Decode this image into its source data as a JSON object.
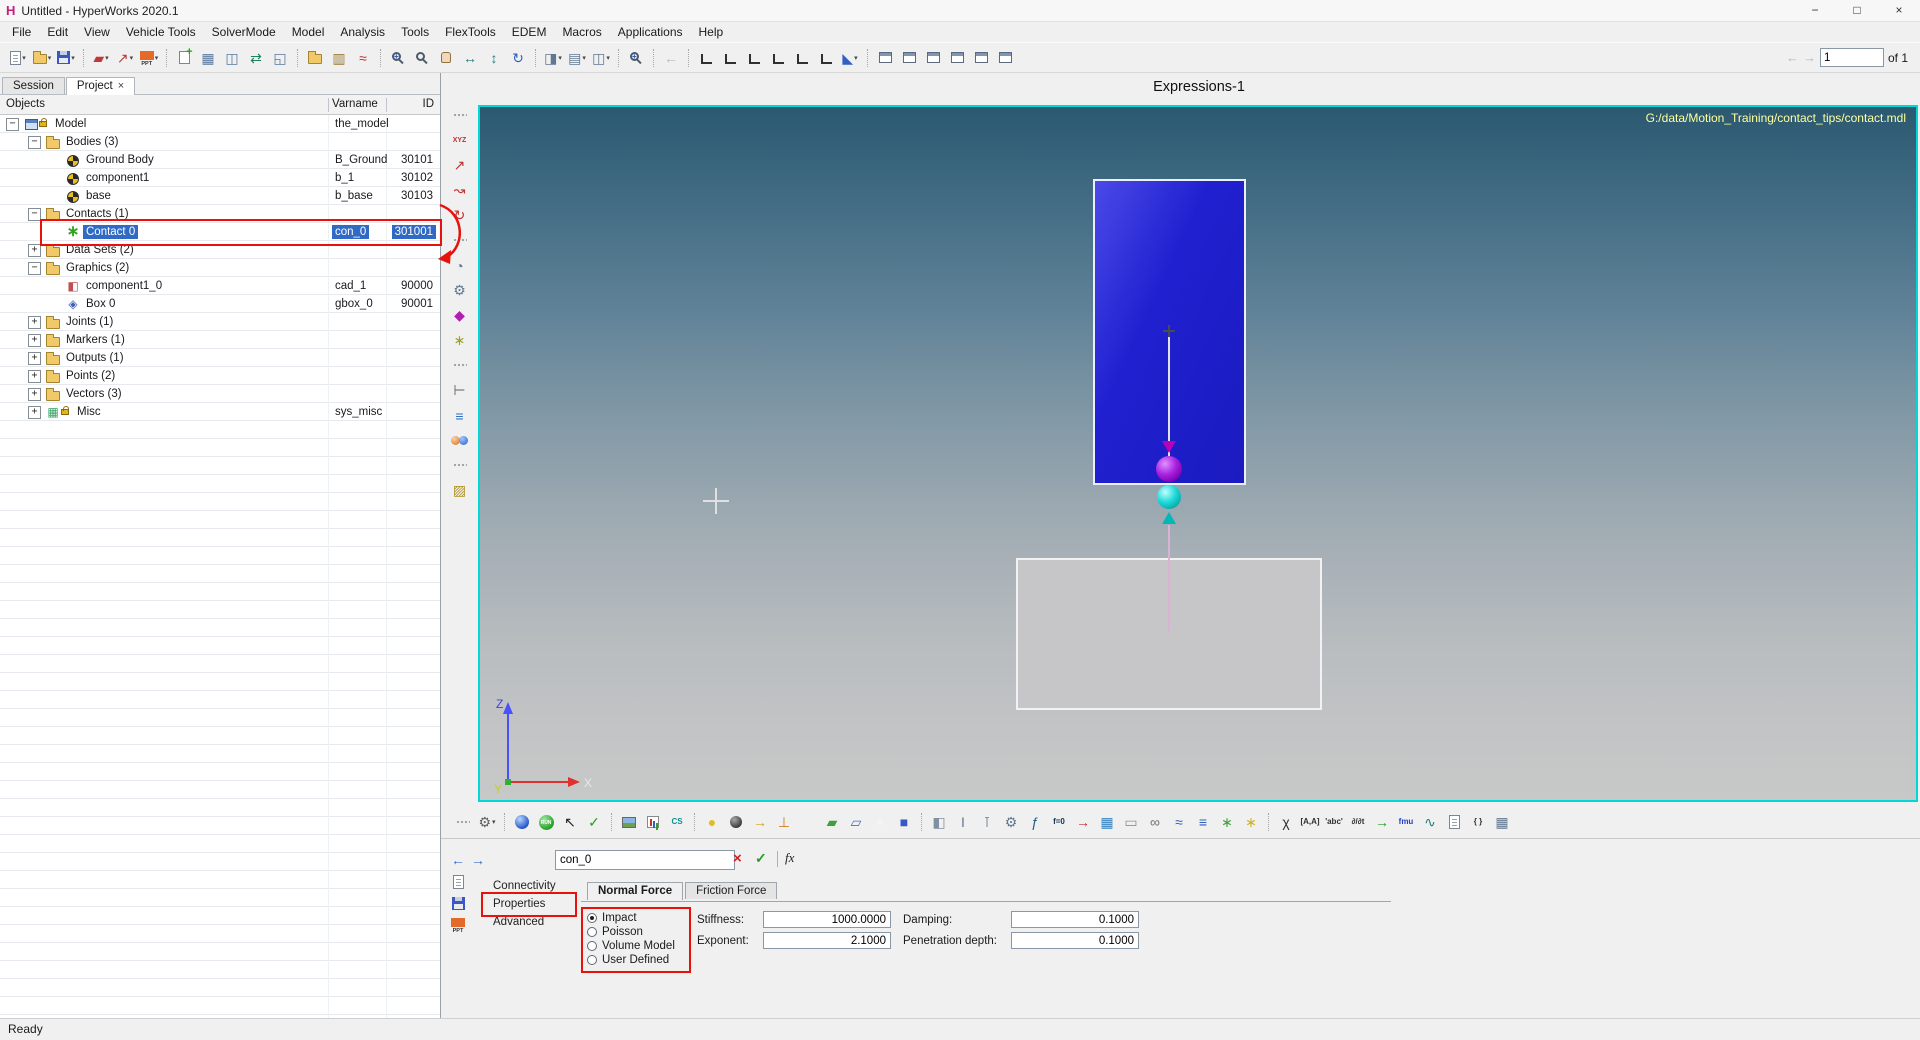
{
  "window": {
    "logo": "H",
    "title": "Untitled - HyperWorks 2020.1",
    "status": "Ready",
    "controls": {
      "minimize": "−",
      "maximize": "□",
      "close": "×"
    }
  },
  "menu": {
    "items": [
      "File",
      "Edit",
      "View",
      "Vehicle Tools",
      "SolverMode",
      "Model",
      "Analysis",
      "Tools",
      "FlexTools",
      "EDEM",
      "Macros",
      "Applications",
      "Help"
    ]
  },
  "toolbar": {
    "right": {
      "back": "←",
      "forward": "→",
      "page_value": "1",
      "page_of": "of 1"
    },
    "groups": [
      [
        {
          "n": "new-session-icon",
          "k": "page",
          "dd": true
        },
        {
          "n": "open-file-icon",
          "k": "folder",
          "dd": true
        },
        {
          "n": "save-file-icon",
          "k": "floppy",
          "dd": true
        }
      ],
      [
        {
          "n": "annotation-tool-icon",
          "g": "▰",
          "c": "#c03838",
          "dd": true
        },
        {
          "n": "measure-tool-icon",
          "g": "↗",
          "c": "#c03838",
          "dd": true
        },
        {
          "n": "ppt-export-icon",
          "g": "PPT",
          "k": "ppt",
          "dd": true
        }
      ],
      [
        {
          "n": "add-page-icon",
          "k": "addpage"
        },
        {
          "n": "page-layout-icon",
          "g": "▦",
          "c": "#5878a0"
        },
        {
          "n": "split-window-icon",
          "g": "◫",
          "c": "#5878a0"
        },
        {
          "n": "swap-windows-icon",
          "g": "⇄",
          "c": "#208060"
        },
        {
          "n": "expand-window-icon",
          "g": "◱",
          "c": "#5878a0"
        }
      ],
      [
        {
          "n": "organize-sessions-icon",
          "k": "folder"
        },
        {
          "n": "session-report-icon",
          "g": "▥",
          "c": "#9a7830"
        },
        {
          "n": "plot-curve-icon",
          "g": "≈",
          "c": "#c03030"
        }
      ],
      [
        {
          "n": "zoom-in-icon",
          "k": "magplus"
        },
        {
          "n": "zoom-window-icon",
          "k": "mag"
        },
        {
          "n": "pan-icon",
          "k": "hand"
        },
        {
          "n": "fit-horizontal-icon",
          "g": "↔",
          "c": "#208080"
        },
        {
          "n": "fit-vertical-icon",
          "g": "↕",
          "c": "#208080"
        },
        {
          "n": "free-rotate-icon",
          "g": "↻",
          "c": "#3060c0"
        }
      ],
      [
        {
          "n": "copy-icon",
          "g": "◨",
          "c": "#607890",
          "dd": true
        },
        {
          "n": "paste-icon",
          "g": "▤",
          "c": "#607890",
          "dd": true
        },
        {
          "n": "capture-image-icon",
          "g": "◫",
          "c": "#607890",
          "dd": true
        }
      ],
      [
        {
          "n": "screen-zoom-icon",
          "k": "magplus"
        }
      ],
      [
        {
          "n": "view-back-arrow-icon",
          "g": "←",
          "c": "#b8b8b8"
        }
      ],
      [
        {
          "n": "view-top-icon",
          "k": "view"
        },
        {
          "n": "view-bottom-icon",
          "k": "view"
        },
        {
          "n": "view-left-icon",
          "k": "view"
        },
        {
          "n": "view-right-icon",
          "k": "view"
        },
        {
          "n": "view-front-icon",
          "k": "view"
        },
        {
          "n": "view-rear-icon",
          "k": "view"
        },
        {
          "n": "iso-view-icon",
          "g": "◣",
          "c": "#3060c0",
          "dd": true
        }
      ],
      [
        {
          "n": "new-window-icon",
          "k": "win"
        },
        {
          "n": "cascade-windows-icon",
          "k": "win"
        },
        {
          "n": "tile-horizontal-icon",
          "k": "win"
        },
        {
          "n": "tile-vertical-icon",
          "k": "win"
        },
        {
          "n": "restore-windows-icon",
          "k": "win"
        },
        {
          "n": "close-window-icon",
          "k": "win"
        }
      ]
    ]
  },
  "browser": {
    "tabs": [
      {
        "label": "Session"
      },
      {
        "label": "Project",
        "close": "×"
      }
    ],
    "columns": {
      "objects": "Objects",
      "varname": "Varname",
      "id": "ID"
    },
    "rows": [
      {
        "label": "Model",
        "var": "the_model",
        "id": "",
        "lvl": 0,
        "exp": "minus",
        "icon": "model",
        "lock": true
      },
      {
        "label": "Bodies (3)",
        "var": "",
        "id": "",
        "lvl": 1,
        "exp": "minus",
        "icon": "folder"
      },
      {
        "label": "Ground Body",
        "var": "B_Ground",
        "id": "30101",
        "lvl": 2,
        "icon": "body"
      },
      {
        "label": "component1",
        "var": "b_1",
        "id": "30102",
        "lvl": 2,
        "icon": "body"
      },
      {
        "label": "base",
        "var": "b_base",
        "id": "30103",
        "lvl": 2,
        "icon": "body"
      },
      {
        "label": "Contacts (1)",
        "var": "",
        "id": "",
        "lvl": 1,
        "exp": "minus",
        "icon": "folder"
      },
      {
        "label": "Contact 0",
        "var": "con_0",
        "id": "301001",
        "lvl": 2,
        "icon": "contact",
        "selected": true
      },
      {
        "label": "Data Sets (2)",
        "var": "",
        "id": "",
        "lvl": 1,
        "exp": "plus",
        "icon": "folder"
      },
      {
        "label": "Graphics (2)",
        "var": "",
        "id": "",
        "lvl": 1,
        "exp": "minus",
        "icon": "folder"
      },
      {
        "label": "component1_0",
        "var": "cad_1",
        "id": "90000",
        "lvl": 2,
        "icon": "cad"
      },
      {
        "label": "Box 0",
        "var": "gbox_0",
        "id": "90001",
        "lvl": 2,
        "icon": "gbox"
      },
      {
        "label": "Joints (1)",
        "var": "",
        "id": "",
        "lvl": 1,
        "exp": "plus",
        "icon": "folder"
      },
      {
        "label": "Markers (1)",
        "var": "",
        "id": "",
        "lvl": 1,
        "exp": "plus",
        "icon": "folder"
      },
      {
        "label": "Outputs (1)",
        "var": "",
        "id": "",
        "lvl": 1,
        "exp": "plus",
        "icon": "folder"
      },
      {
        "label": "Points (2)",
        "var": "",
        "id": "",
        "lvl": 1,
        "exp": "plus",
        "icon": "folder"
      },
      {
        "label": "Vectors (3)",
        "var": "",
        "id": "",
        "lvl": 1,
        "exp": "plus",
        "icon": "folder"
      },
      {
        "label": "Misc",
        "var": "sys_misc",
        "id": "",
        "lvl": 1,
        "exp": "plus",
        "icon": "misc",
        "lock": true
      }
    ]
  },
  "side_toolbar": {
    "icons": [
      {
        "n": "grip",
        "k": "grip"
      },
      {
        "n": "xyz-triad-icon",
        "g": "XYZ",
        "c": "#c03030",
        "sm": true
      },
      {
        "n": "translate-tool-icon",
        "g": "↗",
        "c": "#c03030"
      },
      {
        "n": "trace-tool-icon",
        "g": "↝",
        "c": "#c03030"
      },
      {
        "n": "rotate-tool-icon",
        "g": "↻",
        "c": "#c03030"
      },
      {
        "n": "grip",
        "k": "grip"
      },
      {
        "n": "protractor-icon",
        "g": "◔",
        "c": "#607890"
      },
      {
        "n": "mechanism-icon",
        "g": "⚙",
        "c": "#607890"
      },
      {
        "n": "marker-tool-icon",
        "g": "◆",
        "c": "#b020b0"
      },
      {
        "n": "snap-tool-icon",
        "g": "∗",
        "c": "#a0a020"
      },
      {
        "n": "grip",
        "k": "grip"
      },
      {
        "n": "ruler-icon",
        "g": "⊢",
        "c": "#606060"
      },
      {
        "n": "legend-bars-icon",
        "g": "≡",
        "c": "#3070c0"
      },
      {
        "n": "contact-spheres-icon",
        "k": "balls"
      },
      {
        "n": "grip",
        "k": "grip"
      },
      {
        "n": "paint-tool-icon",
        "g": "▨",
        "c": "#b09020"
      }
    ]
  },
  "viewport": {
    "title": "Expressions-1",
    "file_path": "G:/data/Motion_Training/contact_tips/contact.mdl",
    "axis": {
      "x": "X",
      "y": "Y",
      "z": "Z"
    }
  },
  "bottom_toolbar": {
    "groups": [
      [
        {
          "n": "grip",
          "k": "grip"
        },
        {
          "n": "model-tools-icon",
          "g": "⚙",
          "c": "#606060",
          "dd": true
        }
      ],
      [
        {
          "n": "sphere-display-icon",
          "k": "sphereblue"
        },
        {
          "n": "run-solver-icon",
          "g": "RUN",
          "k": "run"
        },
        {
          "n": "select-cursor-icon",
          "g": "↖",
          "c": "#202020"
        },
        {
          "n": "verify-model-icon",
          "g": "✓",
          "c": "#20a020"
        }
      ],
      [
        {
          "n": "snapshot-icon",
          "k": "photo"
        },
        {
          "n": "plot-window-icon",
          "k": "chart"
        },
        {
          "n": "cs-marker-icon",
          "g": "CS",
          "c": "#109090",
          "sm": true
        }
      ],
      [
        {
          "n": "point-entity-icon",
          "g": "●",
          "c": "#e0c020"
        },
        {
          "n": "body-entity-icon",
          "k": "balldark"
        },
        {
          "n": "vector-entity-icon",
          "g": "→",
          "c": "#d0a020"
        },
        {
          "n": "marker-entity-icon",
          "g": "⊥",
          "c": "#d08020"
        },
        {
          "n": "asterisk-entity-icon",
          "g": "∗",
          "c": "#f0f0f0"
        },
        {
          "n": "surface-entity-icon",
          "g": "▰",
          "c": "#40a040"
        },
        {
          "n": "plane-entity-icon",
          "g": "▱",
          "c": "#4070d0"
        },
        {
          "n": "cross-entity-icon",
          "g": "+",
          "c": "#f8f8f8"
        },
        {
          "n": "solid-entity-icon",
          "g": "■",
          "c": "#3858c8"
        }
      ],
      [
        {
          "n": "rigid-group-icon",
          "g": "◧",
          "c": "#8090a0"
        },
        {
          "n": "beam-icon",
          "g": "I",
          "c": "#607890"
        },
        {
          "n": "pin-joint-icon",
          "g": "⊺",
          "c": "#607890"
        },
        {
          "n": "gear-joint-icon",
          "g": "⚙",
          "c": "#607890"
        },
        {
          "n": "force-icon",
          "g": "ƒ",
          "c": "#206080"
        },
        {
          "n": "equation-icon",
          "g": "f=0",
          "c": "#103050",
          "sm": true
        },
        {
          "n": "output-request-icon",
          "g": "→",
          "c": "#c03030"
        },
        {
          "n": "table-icon",
          "g": "▦",
          "c": "#3080c0"
        },
        {
          "n": "capsule-icon",
          "g": "▭",
          "c": "#909090"
        },
        {
          "n": "contact-pair-icon",
          "g": "∞",
          "c": "#707070"
        },
        {
          "n": "bushing-icon",
          "g": "≈",
          "c": "#3060c0"
        },
        {
          "n": "layers-icon",
          "g": "≡",
          "c": "#3060c0"
        },
        {
          "n": "coupler-icon",
          "g": "∗",
          "c": "#40a040"
        },
        {
          "n": "flexbody-icon",
          "g": "∗",
          "c": "#d0b020"
        }
      ],
      [
        {
          "n": "expression-icon",
          "g": "χ",
          "c": "#303030"
        },
        {
          "n": "matrix-icon",
          "g": "[A,A]",
          "c": "#303030",
          "sm": true
        },
        {
          "n": "string-icon",
          "g": "'abc'",
          "c": "#303030",
          "sm": true
        },
        {
          "n": "derivative-icon",
          "g": "∂/∂t",
          "c": "#303030",
          "sm": true
        },
        {
          "n": "assign-icon",
          "g": "→",
          "c": "#20a020"
        },
        {
          "n": "fmu-icon",
          "g": "fmu",
          "c": "#2040c0",
          "sm": true
        },
        {
          "n": "signal-icon",
          "g": "∿",
          "c": "#208080"
        },
        {
          "n": "template-icon",
          "k": "page"
        },
        {
          "n": "braces-icon",
          "g": "{ }",
          "c": "#303030",
          "sm": true
        },
        {
          "n": "spreadsheet-icon",
          "g": "▦",
          "c": "#607890"
        }
      ]
    ]
  },
  "panel": {
    "nav": {
      "back": "←",
      "forward": "→"
    },
    "entity_value": "con_0",
    "buttons": {
      "cancel": "×",
      "apply": "✓",
      "fx": "fx"
    },
    "tabs": [
      {
        "label": "Connectivity"
      },
      {
        "label": "Properties",
        "annotated": true
      },
      {
        "label": "Advanced"
      }
    ],
    "force_tabs": [
      {
        "label": "Normal Force",
        "active": true
      },
      {
        "label": "Friction Force"
      }
    ],
    "model_options": [
      {
        "label": "Impact",
        "selected": true
      },
      {
        "label": "Poisson"
      },
      {
        "label": "Volume Model"
      },
      {
        "label": "User Defined"
      }
    ],
    "fields": [
      {
        "label": "Stiffness:",
        "value": "1000.0000"
      },
      {
        "label": "Damping:",
        "value": "0.1000"
      },
      {
        "label": "Exponent:",
        "value": "2.1000"
      },
      {
        "label": "Penetration depth:",
        "value": "0.1000"
      }
    ]
  },
  "annotations": {
    "color": "#e8120c",
    "items": [
      "contact-row",
      "properties-tab",
      "normal-force-model-options"
    ]
  },
  "colors": {
    "selection": "#316ac5",
    "viewport_border": "#00d8d8",
    "contact_body_blue": "#2020d0",
    "base_body_gray": "#c6c6c8",
    "upper_sphere_purple": "#a820e0",
    "lower_sphere_cyan": "#20d8d8",
    "path_text_yellow": "#ffffa0"
  }
}
